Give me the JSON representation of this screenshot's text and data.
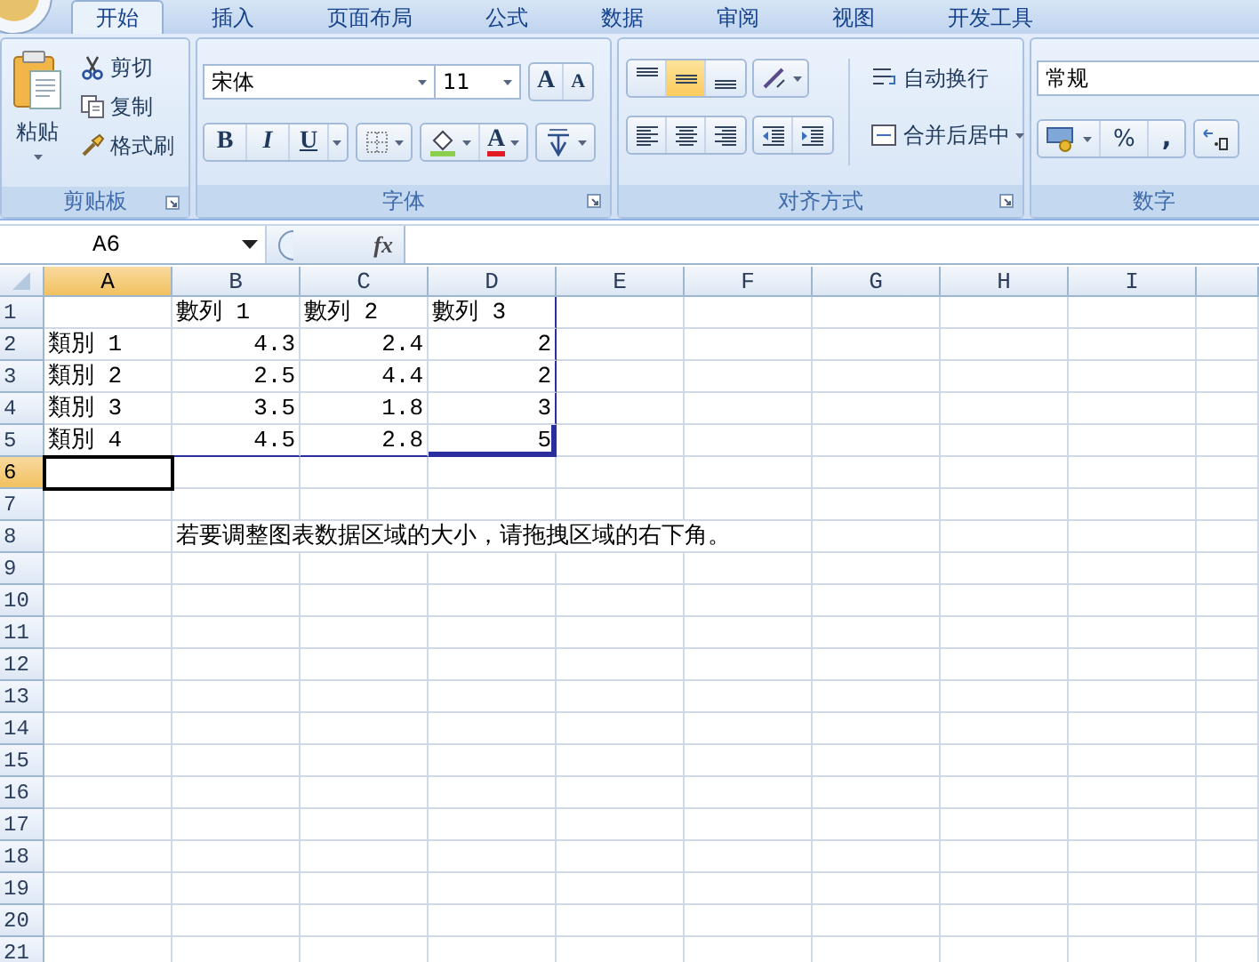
{
  "ribbon_tabs": [
    {
      "label": "开始",
      "selected": true
    },
    {
      "label": "插入",
      "selected": false
    },
    {
      "label": "页面布局",
      "selected": false
    },
    {
      "label": "公式",
      "selected": false
    },
    {
      "label": "数据",
      "selected": false
    },
    {
      "label": "审阅",
      "selected": false
    },
    {
      "label": "视图",
      "selected": false
    },
    {
      "label": "开发工具",
      "selected": false
    }
  ],
  "clipboard": {
    "paste": "粘贴",
    "cut": "剪切",
    "copy": "复制",
    "format_painter": "格式刷",
    "group_label": "剪贴板"
  },
  "font": {
    "font_name": "宋体",
    "font_size": "11",
    "grow": "A",
    "shrink": "A",
    "bold": "B",
    "italic": "I",
    "underline": "U",
    "font_color": "A",
    "group_label": "字体"
  },
  "alignment": {
    "buttons": [
      {
        "kind": "top",
        "selected": false
      },
      {
        "kind": "middle",
        "selected": true
      },
      {
        "kind": "bottom",
        "selected": false
      },
      {
        "kind": "orientation",
        "selected": false
      },
      {
        "kind": "left",
        "selected": false
      },
      {
        "kind": "center",
        "selected": false
      },
      {
        "kind": "right",
        "selected": false
      },
      {
        "kind": "outdent",
        "selected": false
      },
      {
        "kind": "indent",
        "selected": false
      }
    ],
    "wrap_text": "自动换行",
    "merge_center": "合并后居中",
    "group_label": "对齐方式"
  },
  "number": {
    "format": "常规",
    "percent": "%",
    "comma": ",",
    "group_label": "数字"
  },
  "formula_bar": {
    "name_box": "A6",
    "fx": "fx"
  },
  "sheet": {
    "columns": [
      {
        "label": "A",
        "selected": true
      },
      {
        "label": "B",
        "selected": false
      },
      {
        "label": "C",
        "selected": false
      },
      {
        "label": "D",
        "selected": false
      },
      {
        "label": "E",
        "selected": false
      },
      {
        "label": "F",
        "selected": false
      },
      {
        "label": "G",
        "selected": false
      },
      {
        "label": "H",
        "selected": false
      },
      {
        "label": "I",
        "selected": false
      }
    ],
    "rows": [
      {
        "label": "1",
        "selected": false,
        "cells": [
          {
            "kind": "empty"
          },
          {
            "kind": "text",
            "text": "數列 1"
          },
          {
            "kind": "text",
            "text": "數列 2"
          },
          {
            "kind": "text",
            "text": "數列 3",
            "range_right": true
          }
        ]
      },
      {
        "label": "2",
        "selected": false,
        "cells": [
          {
            "kind": "text",
            "text": "類別 1"
          },
          {
            "kind": "number",
            "text": "4.3"
          },
          {
            "kind": "number",
            "text": "2.4"
          },
          {
            "kind": "number",
            "text": "2",
            "range_right": true
          }
        ]
      },
      {
        "label": "3",
        "selected": false,
        "cells": [
          {
            "kind": "text",
            "text": "類別 2"
          },
          {
            "kind": "number",
            "text": "2.5"
          },
          {
            "kind": "number",
            "text": "4.4"
          },
          {
            "kind": "number",
            "text": "2",
            "range_right": true
          }
        ]
      },
      {
        "label": "4",
        "selected": false,
        "cells": [
          {
            "kind": "text",
            "text": "類別 3"
          },
          {
            "kind": "number",
            "text": "3.5"
          },
          {
            "kind": "number",
            "text": "1.8"
          },
          {
            "kind": "number",
            "text": "3",
            "range_right": true
          }
        ]
      },
      {
        "label": "5",
        "selected": false,
        "cells": [
          {
            "kind": "text",
            "text": "類別 4",
            "range_bottom": true
          },
          {
            "kind": "number",
            "text": "4.5",
            "range_bottom": true
          },
          {
            "kind": "number",
            "text": "2.8",
            "range_bottom": true
          },
          {
            "kind": "number",
            "text": "5",
            "range_right": true,
            "range_bottom": true
          }
        ]
      },
      {
        "label": "6",
        "selected": true,
        "cells": [
          {
            "kind": "empty",
            "active": true
          }
        ]
      },
      {
        "label": "7",
        "selected": false,
        "cells": []
      },
      {
        "label": "8",
        "selected": false,
        "cells": [
          {
            "kind": "empty"
          },
          {
            "kind": "text",
            "text": "若要调整图表数据区域的大小，请拖拽区域的右下角。"
          }
        ]
      },
      {
        "label": "9",
        "selected": false,
        "cells": []
      },
      {
        "label": "10",
        "selected": false,
        "cells": []
      },
      {
        "label": "11",
        "selected": false,
        "cells": []
      },
      {
        "label": "12",
        "selected": false,
        "cells": []
      },
      {
        "label": "13",
        "selected": false,
        "cells": []
      },
      {
        "label": "14",
        "selected": false,
        "cells": []
      },
      {
        "label": "15",
        "selected": false,
        "cells": []
      },
      {
        "label": "16",
        "selected": false,
        "cells": []
      },
      {
        "label": "17",
        "selected": false,
        "cells": []
      },
      {
        "label": "18",
        "selected": false,
        "cells": []
      },
      {
        "label": "19",
        "selected": false,
        "cells": []
      },
      {
        "label": "20",
        "selected": false,
        "cells": []
      },
      {
        "label": "21",
        "selected": false,
        "cells": []
      }
    ]
  }
}
